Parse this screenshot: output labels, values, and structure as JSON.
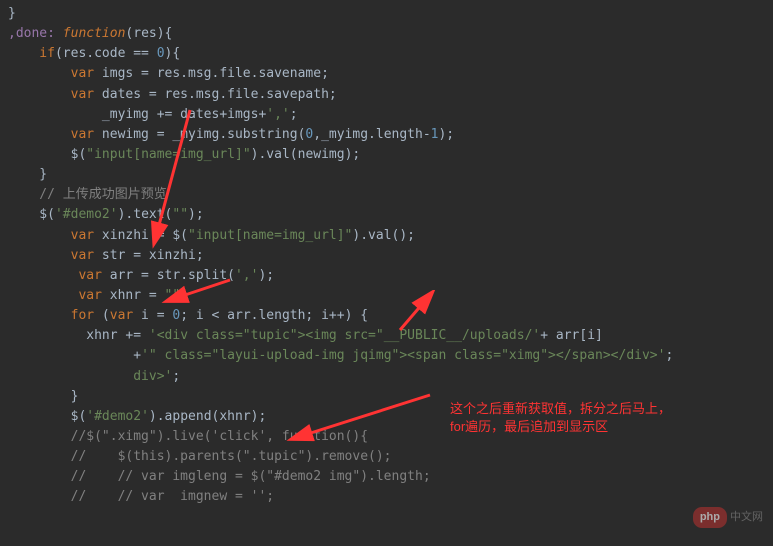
{
  "code": {
    "l1": "}",
    "l2_done": ",done: ",
    "l2_func": "function",
    "l2_rest": "(res){",
    "l3_if": "    if",
    "l3_rest": "(res.code == ",
    "l3_num": "0",
    "l3_end": "){",
    "l4_var": "        var",
    "l4_rest": " imgs = res.msg.file.savename;",
    "l5_var": "        var",
    "l5_rest": " dates = res.msg.file.savepath;",
    "l6_a": "            _myimg += dates+imgs+",
    "l6_str": "','",
    "l6_end": ";",
    "l7_var": "        var",
    "l7_mid": " newimg = _myimg.substring(",
    "l7_n0": "0",
    "l7_mid2": ",_myimg.length-",
    "l7_n1": "1",
    "l7_end": ");",
    "l8_a": "        $(",
    "l8_str": "\"input[name=img_url]\"",
    "l8_mid": ").val(newimg);",
    "l9": "    }",
    "l10_cmt": "    // 上传成功图片预览",
    "l11_a": "    $(",
    "l11_str": "'#demo2'",
    "l11_mid": ").text(",
    "l11_str2": "\"\"",
    "l11_end": ");",
    "l12_var": "        var",
    "l12_mid": " xinzhi = $(",
    "l12_str": "\"input[name=img_url]\"",
    "l12_end": ").val();",
    "l13_var": "        var",
    "l13_rest": " str = xinzhi;",
    "l14_var": "         var",
    "l14_mid": " arr = str.split(",
    "l14_str": "','",
    "l14_end": ");",
    "l15_var": "         var",
    "l15_mid": " xhnr = ",
    "l15_str": "\"\"",
    "l15_end": ";",
    "l16_for": "        for",
    "l16_a": " (",
    "l16_var": "var",
    "l16_b": " i = ",
    "l16_n0": "0",
    "l16_c": "; i < arr.length; i++) {",
    "l17_a": "          xhnr += ",
    "l17_s1": "'<div class=\"tupic\"><img src=\"__PUBLIC__/uploads/'",
    "l17_b": "+ arr[i]",
    "l18_a": "                +",
    "l18_s1": "'\" class=\"layui-upload-img jqimg\"><span class=\"ximg\"></span></div>'",
    "l18_end": ";",
    "l18a_tail": "                div>';",
    "l19": "        }",
    "l20_a": "        $(",
    "l20_str": "'#demo2'",
    "l20_mid": ").append(xhnr);",
    "l21_cmt": "        //$(\".ximg\").live('click', function(){",
    "l22_cmt": "        //    $(this).parents(\".tupic\").remove();",
    "l23_cmt": "        //    // var imgleng = $(\"#demo2 img\").length;",
    "l24_cmt": "        //    // var  imgnew = '';"
  },
  "annotation": {
    "line1": "这个之后重新获取值，拆分之后马上，",
    "line2": "for遍历，最后追加到显示区"
  },
  "watermark": {
    "pill": "php",
    "text": "中文网"
  }
}
